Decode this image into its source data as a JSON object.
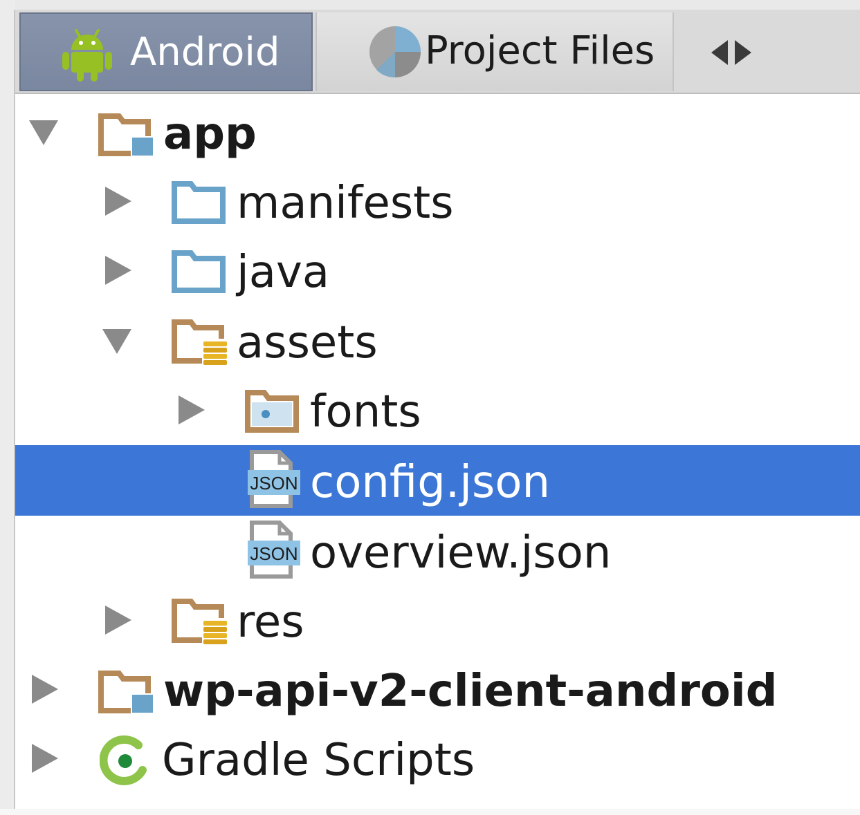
{
  "tabs": [
    {
      "label": "Android",
      "icon": "android-icon",
      "selected": true
    },
    {
      "label": "Project Files",
      "icon": "project-files-icon",
      "selected": false
    }
  ],
  "tab_scroll_icon": "left-right-arrows-icon",
  "tree": {
    "app": {
      "label": "app",
      "expanded": true,
      "icon": "module-folder-icon"
    },
    "manifests": {
      "label": "manifests",
      "expanded": false,
      "icon": "folder-icon"
    },
    "java": {
      "label": "java",
      "expanded": false,
      "icon": "folder-icon"
    },
    "assets": {
      "label": "assets",
      "expanded": true,
      "icon": "resource-folder-icon"
    },
    "fonts": {
      "label": "fonts",
      "expanded": false,
      "icon": "package-folder-icon"
    },
    "config": {
      "label": "config.json",
      "selected": true,
      "icon": "json-file-icon"
    },
    "overview": {
      "label": "overview.json",
      "selected": false,
      "icon": "json-file-icon"
    },
    "res": {
      "label": "res",
      "expanded": false,
      "icon": "resource-folder-icon"
    },
    "wp": {
      "label": "wp-api-v2-client-android",
      "expanded": false,
      "icon": "module-folder-icon"
    },
    "gradle": {
      "label": "Gradle Scripts",
      "expanded": false,
      "icon": "gradle-icon"
    }
  },
  "colors": {
    "selection": "#3c76d6",
    "folder_tan": "#b58a58",
    "folder_blue": "#6aa3c9",
    "android_green": "#97c024"
  }
}
